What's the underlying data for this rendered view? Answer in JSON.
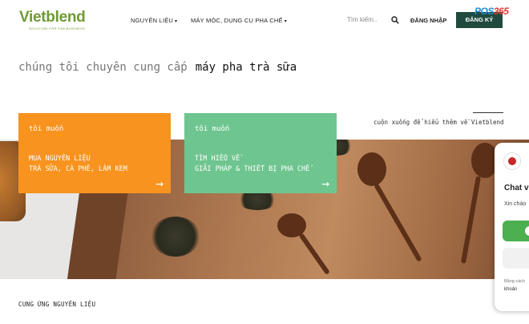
{
  "header": {
    "logo": {
      "brand": "Vietblend",
      "tagline": "SOLUTION FOR F&B BUSINESS"
    },
    "nav": [
      {
        "label": "NGUYÊN LIỆU"
      },
      {
        "label": "MÁY MÓC, DỤNG CỤ PHA CHẾ"
      }
    ],
    "search": {
      "placeholder": "Tìm kiếm..",
      "icon": "search-icon"
    },
    "login_label": "ĐĂNG NHẬP",
    "register_label": "ĐĂNG KÝ",
    "register_color": "#1f4a3d",
    "badge": {
      "part1": "POS",
      "part2": "365"
    }
  },
  "hero": {
    "prefix": "chúng tôi chuyên cung cấp",
    "highlight": "máy pha trà sữa"
  },
  "scroll_hint": "cuộn xuống để hiểu thêm về Vietblend",
  "cards": [
    {
      "kicker": "tôi muốn",
      "line1": "MUA NGUYÊN LIỆU",
      "line2": "TRÀ SỮA, CÀ PHÊ, LÀM KEM",
      "arrow": "→",
      "color": "#f7931e"
    },
    {
      "kicker": "tôi muốn",
      "line1": "TÌM HIỂU VỀ",
      "line2": "GIẢI PHÁP & THIẾT BỊ PHA CHẾ",
      "arrow": "→",
      "color": "#6fc58f"
    }
  ],
  "section_title": "CUNG ỨNG NGUYÊN LIỆU",
  "chat": {
    "title": "Chat v",
    "greeting": "Xin chào",
    "footer1": "Bằng cách",
    "footer2": "khoản"
  }
}
